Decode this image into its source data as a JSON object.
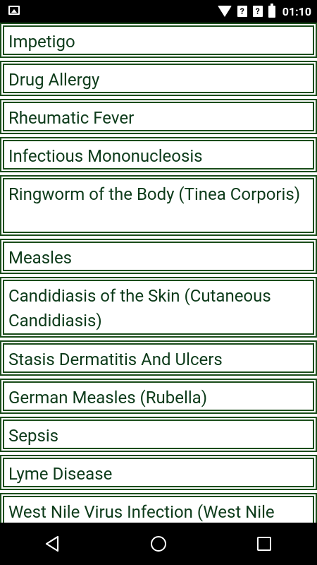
{
  "status": {
    "time": "01:10",
    "q1": "?",
    "q2": "?"
  },
  "list": {
    "items": [
      "Impetigo",
      "Drug Allergy",
      "Rheumatic Fever",
      "Infectious Mononucleosis",
      "Ringworm of the Body (Tinea Corporis)",
      "Measles",
      "Candidiasis of the Skin (Cutaneous Candidiasis)",
      "Stasis Dermatitis And Ulcers",
      "German Measles (Rubella)",
      "Sepsis",
      "Lyme Disease",
      "West Nile Virus Infection (West Nile"
    ]
  }
}
